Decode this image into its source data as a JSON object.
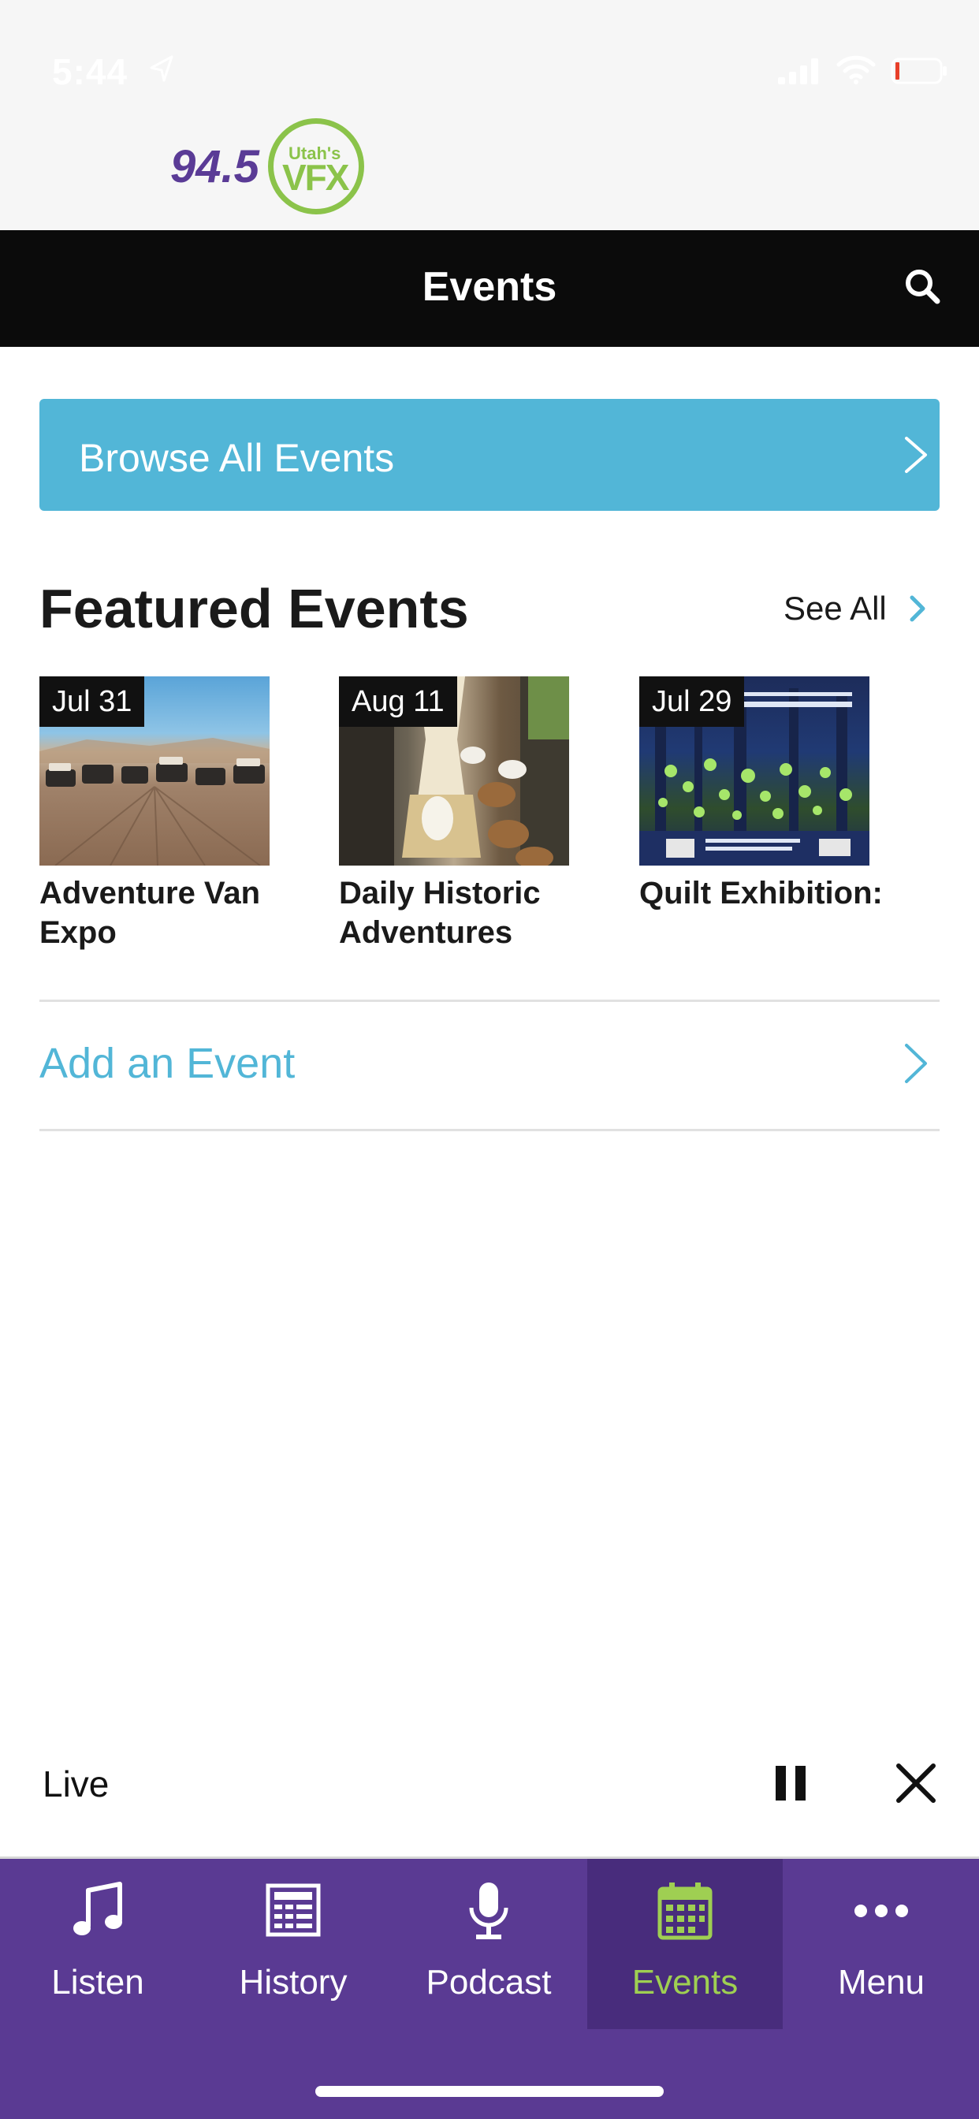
{
  "status_bar": {
    "time": "5:44"
  },
  "logo": {
    "number": "94.5",
    "small_text": "Utah's",
    "big_text": "VFX"
  },
  "header": {
    "title": "Events"
  },
  "browse": {
    "label": "Browse All Events"
  },
  "featured": {
    "title": "Featured Events",
    "see_all": "See All",
    "events": [
      {
        "date": "Jul 31",
        "title": "Adventure Van Expo"
      },
      {
        "date": "Aug 11",
        "title": "Daily Historic Adventures"
      },
      {
        "date": "Jul 29",
        "title": "Quilt Exhibition:"
      }
    ]
  },
  "add_event": {
    "label": "Add an Event"
  },
  "player": {
    "label": "Live"
  },
  "tabs": [
    {
      "label": "Listen",
      "icon": "music-note-icon"
    },
    {
      "label": "History",
      "icon": "newspaper-icon"
    },
    {
      "label": "Podcast",
      "icon": "microphone-icon"
    },
    {
      "label": "Events",
      "icon": "calendar-icon",
      "active": true
    },
    {
      "label": "Menu",
      "icon": "more-dots-icon"
    }
  ],
  "colors": {
    "accent": "#52b6d7",
    "tabbar": "#5a3a93",
    "tab_active_bg": "#482c7c",
    "tab_active_fg": "#9fcf52",
    "header": "#0b0b0b",
    "logo_purple": "#5a3b96",
    "logo_green": "#8bc34a"
  }
}
